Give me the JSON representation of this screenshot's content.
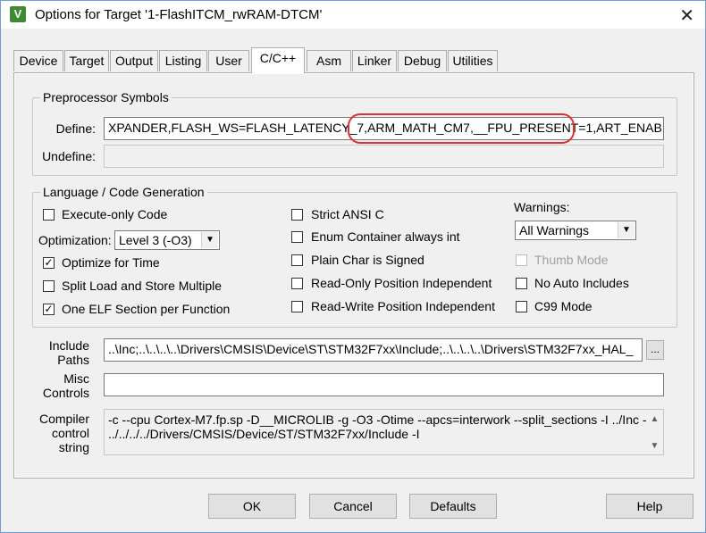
{
  "window": {
    "title": "Options for Target '1-FlashITCM_rwRAM-DTCM'",
    "icon_name": "keil-uvision-icon",
    "close_glyph": "✕"
  },
  "tabs": [
    {
      "label": "Device"
    },
    {
      "label": "Target"
    },
    {
      "label": "Output"
    },
    {
      "label": "Listing"
    },
    {
      "label": "User"
    },
    {
      "label": "C/C++"
    },
    {
      "label": "Asm"
    },
    {
      "label": "Linker"
    },
    {
      "label": "Debug"
    },
    {
      "label": "Utilities"
    }
  ],
  "active_tab": "C/C++",
  "preprocessor": {
    "group_title": "Preprocessor Symbols",
    "define_label": "Define:",
    "define_value": "XPANDER,FLASH_WS=FLASH_LATENCY_7,ARM_MATH_CM7,__FPU_PRESENT=1,ART_ENABLE,PI",
    "undefine_label": "Undefine:",
    "undefine_value": ""
  },
  "language": {
    "group_title": "Language / Code Generation",
    "execute_only": {
      "label": "Execute-only Code",
      "checked": false
    },
    "optimization_label": "Optimization:",
    "optimization_value": "Level 3 (-O3)",
    "optimize_time": {
      "label": "Optimize for Time",
      "checked": true
    },
    "split_load": {
      "label": "Split Load and Store Multiple",
      "checked": false
    },
    "one_elf": {
      "label": "One ELF Section per Function",
      "checked": true
    },
    "strict_ansi": {
      "label": "Strict ANSI C",
      "checked": false
    },
    "enum_container": {
      "label": "Enum Container always int",
      "checked": false
    },
    "plain_char": {
      "label": "Plain Char is Signed",
      "checked": false
    },
    "ro_pi": {
      "label": "Read-Only Position Independent",
      "checked": false
    },
    "rw_pi": {
      "label": "Read-Write Position Independent",
      "checked": false
    },
    "warnings_label": "Warnings:",
    "warnings_value": "All Warnings",
    "thumb_mode": {
      "label": "Thumb Mode",
      "checked": false,
      "disabled": true
    },
    "no_auto_includes": {
      "label": "No Auto Includes",
      "checked": false
    },
    "c99_mode": {
      "label": "C99 Mode",
      "checked": false
    }
  },
  "paths": {
    "include_label_1": "Include",
    "include_label_2": "Paths",
    "include_value": "..\\Inc;..\\..\\..\\..\\Drivers\\CMSIS\\Device\\ST\\STM32F7xx\\Include;..\\..\\..\\..\\Drivers\\STM32F7xx_HAL_",
    "browse_label": "...",
    "misc_label_1": "Misc",
    "misc_label_2": "Controls",
    "misc_value": "",
    "compiler_label_1": "Compiler",
    "compiler_label_2": "control",
    "compiler_label_3": "string",
    "compiler_line_1": "-c --cpu Cortex-M7.fp.sp -D__MICROLIB -g -O3 -Otime --apcs=interwork --split_sections -I ../Inc -I",
    "compiler_line_2": "../../../../Drivers/CMSIS/Device/ST/STM32F7xx/Include -I"
  },
  "buttons": {
    "ok": "OK",
    "cancel": "Cancel",
    "defaults": "Defaults",
    "help": "Help"
  },
  "colors": {
    "annotation": "#e0302e",
    "window_border": "#6d9ed6"
  }
}
